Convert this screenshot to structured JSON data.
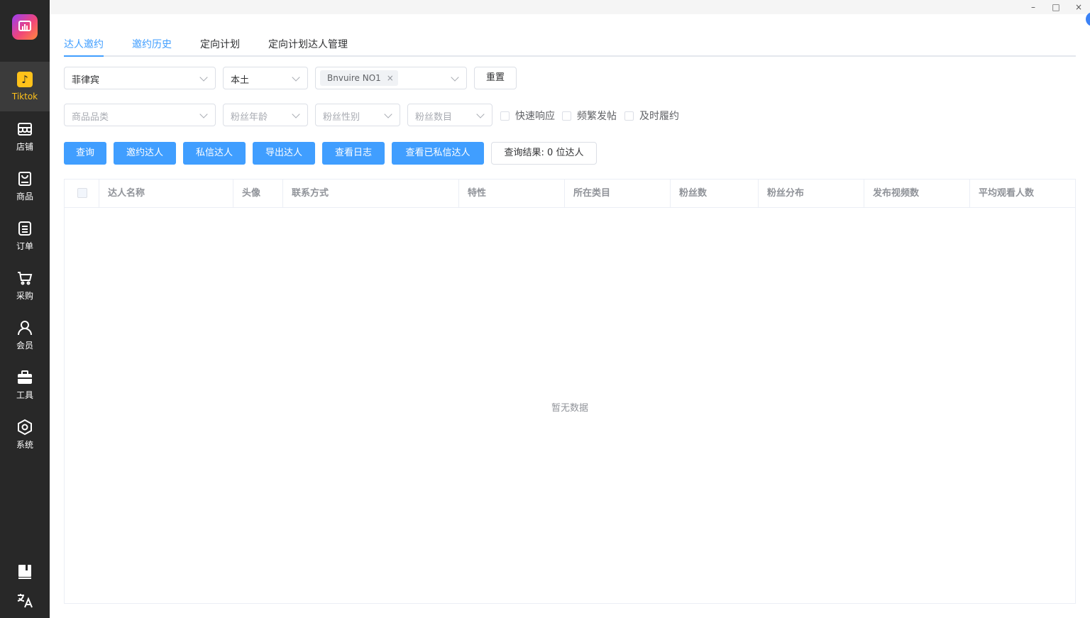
{
  "window": {
    "minimize": "–",
    "maximize": "□",
    "close": "×"
  },
  "sidebar": {
    "items": [
      {
        "label": "Tiktok",
        "icon": "tiktok-icon"
      },
      {
        "label": "店铺",
        "icon": "store-icon"
      },
      {
        "label": "商品",
        "icon": "product-bag-icon"
      },
      {
        "label": "订单",
        "icon": "order-list-icon"
      },
      {
        "label": "采购",
        "icon": "cart-icon"
      },
      {
        "label": "会员",
        "icon": "user-icon"
      },
      {
        "label": "工具",
        "icon": "toolbox-icon"
      },
      {
        "label": "系统",
        "icon": "settings-icon"
      }
    ],
    "bottom": [
      "book-icon",
      "translate-icon"
    ],
    "active_color": "#ffc21a"
  },
  "tabs": [
    {
      "label": "达人邀约",
      "active": true
    },
    {
      "label": "邀约历史"
    },
    {
      "label": "定向计划"
    },
    {
      "label": "定向计划达人管理"
    }
  ],
  "filters": {
    "country": "菲律宾",
    "seller_type": "本土",
    "shop_tag": "Bnvuire NO1",
    "reset": "重置",
    "category_ph": "商品品类",
    "fan_age_ph": "粉丝年龄",
    "fan_gender_ph": "粉丝性别",
    "fan_count_ph": "粉丝数目",
    "checkboxes": [
      "快速响应",
      "频繁发帖",
      "及时履约"
    ]
  },
  "actions": {
    "query": "查询",
    "invite": "邀约达人",
    "message": "私信达人",
    "export": "导出达人",
    "log": "查看日志",
    "messaged": "查看已私信达人",
    "result": "查询结果: 0 位达人"
  },
  "table": {
    "columns": [
      "达人名称",
      "头像",
      "联系方式",
      "特性",
      "所在类目",
      "粉丝数",
      "粉丝分布",
      "发布视频数",
      "平均观看人数"
    ],
    "empty_text": "暂无数据"
  },
  "colors": {
    "primary": "#409eff",
    "sidebar_bg": "#282828"
  }
}
